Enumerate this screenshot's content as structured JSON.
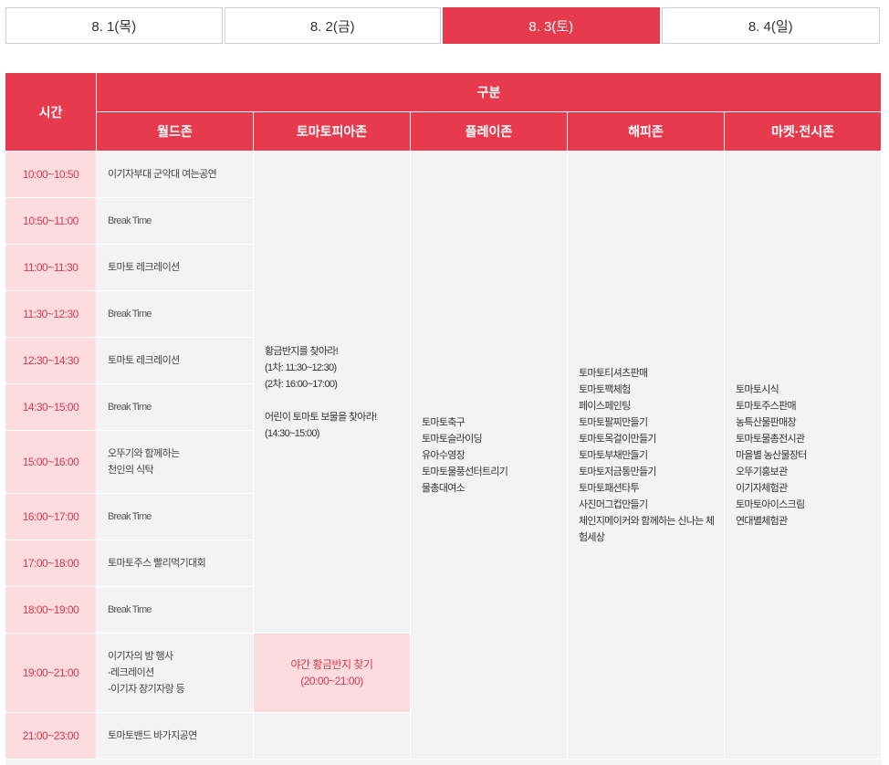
{
  "date_tabs": [
    {
      "label": "8. 1(목)",
      "active": false
    },
    {
      "label": "8. 2(금)",
      "active": false
    },
    {
      "label": "8. 3(토)",
      "active": true
    },
    {
      "label": "8. 4(일)",
      "active": false
    }
  ],
  "header": {
    "time": "시간",
    "category": "구분",
    "zones": [
      "월드존",
      "토마토피아존",
      "플레이존",
      "해피존",
      "마켓·전시존"
    ]
  },
  "times": [
    "10:00~10:50",
    "10:50~11:00",
    "11:00~11:30",
    "11:30~12:30",
    "12:30~14:30",
    "14:30~15:00",
    "15:00~16:00",
    "16:00~17:00",
    "17:00~18:00",
    "18:00~19:00",
    "19:00~21:00",
    "21:00~23:00"
  ],
  "world_zone": [
    [
      "이기자부대 군악대 여는공연"
    ],
    [
      "Break Time"
    ],
    [
      "토마토 레크레이션"
    ],
    [
      "Break Time"
    ],
    [
      "토마토 레크레이션"
    ],
    [
      "Break Time"
    ],
    [
      "오뚜기와 함께하는",
      "천인의 식탁"
    ],
    [
      "Break Time"
    ],
    [
      "토마토주스 빨리먹기대회"
    ],
    [
      "Break Time"
    ],
    [
      "이기자의 밤 행사",
      "-레크레이션",
      "-이기자 장기자랑 등"
    ],
    [
      "토마토밴드 바가지공연"
    ]
  ],
  "tomatopia_zone": {
    "day_lines": [
      "황금반지를 찾아라!",
      "(1차: 11:30~12:30)",
      "(2차: 16:00~17:00)",
      "",
      "어린이 토마토 보물을 찾아라!",
      "(14:30~15:00)"
    ],
    "night_lines": [
      "야간 황금반지 찾기",
      "(20:00~21:00)"
    ]
  },
  "play_zone": [
    "토마토축구",
    "토마토슬라이딩",
    "유아수영장",
    "토마토물풍선터트리기",
    "물총대여소"
  ],
  "happy_zone": [
    "토마토티셔츠판매",
    "토마토팩체험",
    "페이스페인팅",
    "토마토팔찌만들기",
    "토마토목걸이만들기",
    "토마토부채만들기",
    "토마토저금통만들기",
    "토마토패션타투",
    "사진머그컵만들기",
    "체인지메이커와 함께하는 신나는 체",
    "험세상"
  ],
  "market_zone": [
    "토마토시식",
    "토마토주스판매",
    "농특산물판매장",
    "토마토물총전시관",
    "마을별 농산물장터",
    "오뚜기홍보관",
    "이기자체험관",
    "토마토아이스크림",
    "연대별체험관"
  ]
}
